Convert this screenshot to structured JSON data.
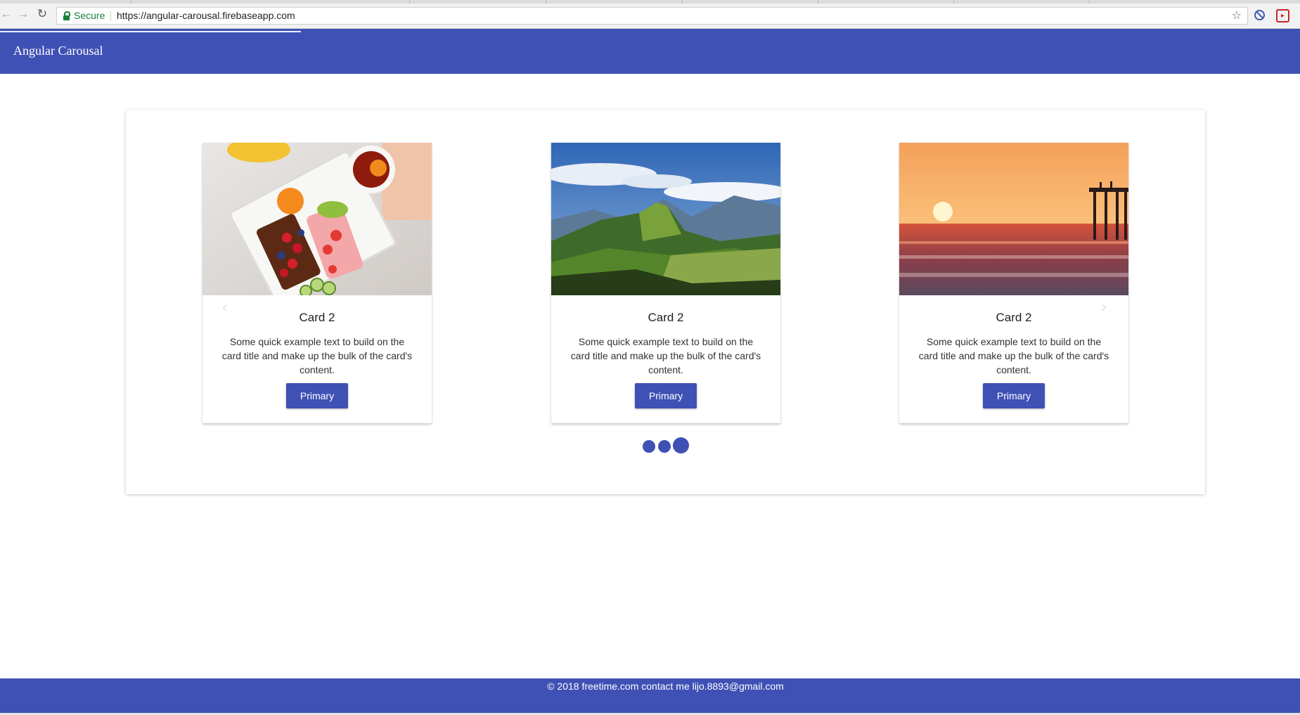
{
  "browser": {
    "secure_label": "Secure",
    "url": "https://angular-carousal.firebaseapp.com"
  },
  "header": {
    "title": "Angular Carousal"
  },
  "carousel": {
    "cards": [
      {
        "title": "Card 2",
        "text": "Some quick example text to build on the card title and make up the bulk of the card's content.",
        "button": "Primary",
        "image": "breakfast-toast-photo"
      },
      {
        "title": "Card 2",
        "text": "Some quick example text to build on the card title and make up the bulk of the card's content.",
        "button": "Primary",
        "image": "mountain-landscape-photo"
      },
      {
        "title": "Card 2",
        "text": "Some quick example text to build on the card title and make up the bulk of the card's content.",
        "button": "Primary",
        "image": "beach-sunset-pier-photo"
      }
    ],
    "prev_icon": "chevron-left-icon",
    "next_icon": "chevron-right-icon",
    "indicator_count": 3,
    "active_indicator": 3
  },
  "footer": {
    "text": "© 2018 freetime.com contact me lijo.8893@gmail.com"
  },
  "colors": {
    "primary": "#3f51b5",
    "secure_green": "#188038"
  }
}
